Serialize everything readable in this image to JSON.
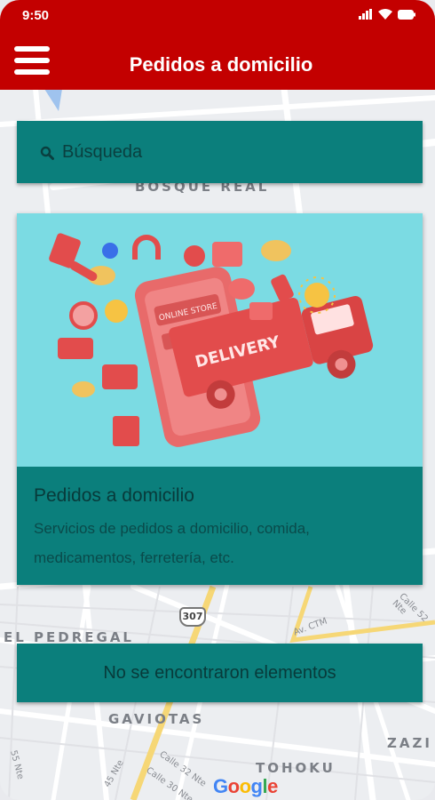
{
  "status_bar": {
    "time": "9:50"
  },
  "header": {
    "title": "Pedidos a domicilio"
  },
  "search": {
    "placeholder": "Búsqueda"
  },
  "card": {
    "image_text_store": "ONLINE STORE",
    "image_text_delivery": "DELIVERY",
    "title": "Pedidos a domicilio",
    "description": "Servicios de pedidos a domicilio, comida, medicamentos, ferretería, etc."
  },
  "empty_state": {
    "message": "No se encontraron elementos"
  },
  "map": {
    "labels": {
      "bosque_real": "BOSQUE REAL",
      "el_pedregal": "EL PEDREGAL",
      "gaviotas": "GAVIOTAS",
      "tohoku": "TOHOKU",
      "zazi": "ZAZI"
    },
    "streets": {
      "av_ctm": "Av. CTM",
      "calle_52_nte": "Calle 52 Nte",
      "calle_32_nte": "Calle 32 Nte",
      "calle_30_nte": "Calle 30 Nte",
      "nte_55": "55 Nte",
      "nte_45": "45 Nte"
    },
    "route_shield": "307",
    "brand": [
      "G",
      "o",
      "o",
      "g",
      "l",
      "e"
    ]
  },
  "colors": {
    "header": "#c30000",
    "teal": "#0b7f7c",
    "image_bg": "#7bdbe3"
  },
  "icons": [
    "menu-icon",
    "search-icon",
    "signal-icon",
    "wifi-icon",
    "battery-icon"
  ]
}
